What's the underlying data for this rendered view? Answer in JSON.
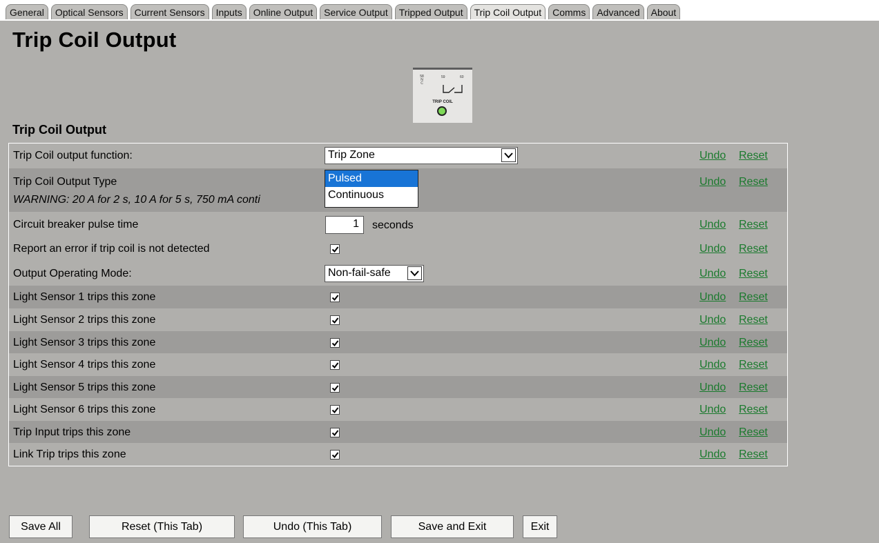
{
  "tabs": [
    "General",
    "Optical Sensors",
    "Current Sensors",
    "Inputs",
    "Online Output",
    "Service Output",
    "Tripped Output",
    "Trip Coil Output",
    "Comms",
    "Advanced",
    "About"
  ],
  "active_tab": "Trip Coil Output",
  "page_title": "Trip Coil Output",
  "device": {
    "pin_58": "58\nN\nC",
    "pin_59": "59",
    "pin_60": "60",
    "label": "TRIP COIL",
    "led_color": "#7ed957"
  },
  "section_title": "Trip Coil Output",
  "undo_label": "Undo",
  "reset_label": "Reset",
  "rows": {
    "function": {
      "label": "Trip Coil output function:",
      "value": "Trip Zone"
    },
    "type": {
      "label": "Trip Coil Output Type",
      "warning": "WARNING: 20 A for 2 s, 10 A for 5 s, 750 mA conti"
    },
    "pulse": {
      "label": "Circuit breaker pulse time",
      "value": "1",
      "unit": "seconds"
    },
    "detect": {
      "label": "Report an error if trip coil is not detected",
      "checked": true
    },
    "mode": {
      "label": "Output Operating Mode:",
      "value": "Non-fail-safe"
    },
    "checks": [
      {
        "label": "Light Sensor 1 trips this zone",
        "checked": true
      },
      {
        "label": "Light Sensor 2 trips this zone",
        "checked": true
      },
      {
        "label": "Light Sensor 3 trips this zone",
        "checked": true
      },
      {
        "label": "Light Sensor 4 trips this zone",
        "checked": true
      },
      {
        "label": "Light Sensor 5 trips this zone",
        "checked": true
      },
      {
        "label": "Light Sensor 6 trips this zone",
        "checked": true
      },
      {
        "label": "Trip Input trips this zone",
        "checked": true
      },
      {
        "label": "Link Trip trips this zone",
        "checked": true
      }
    ]
  },
  "dropdown_options": [
    "Pulsed",
    "Continuous"
  ],
  "dropdown_selected": "Pulsed",
  "buttons": {
    "save_all": "Save All",
    "reset_tab": "Reset (This Tab)",
    "undo_tab": "Undo (This Tab)",
    "save_exit": "Save and Exit",
    "exit": "Exit"
  },
  "colors": {
    "background": "#b0afac",
    "shaded_row": "#9d9c9a",
    "link": "#1a7a2d",
    "selection": "#1874d6"
  }
}
